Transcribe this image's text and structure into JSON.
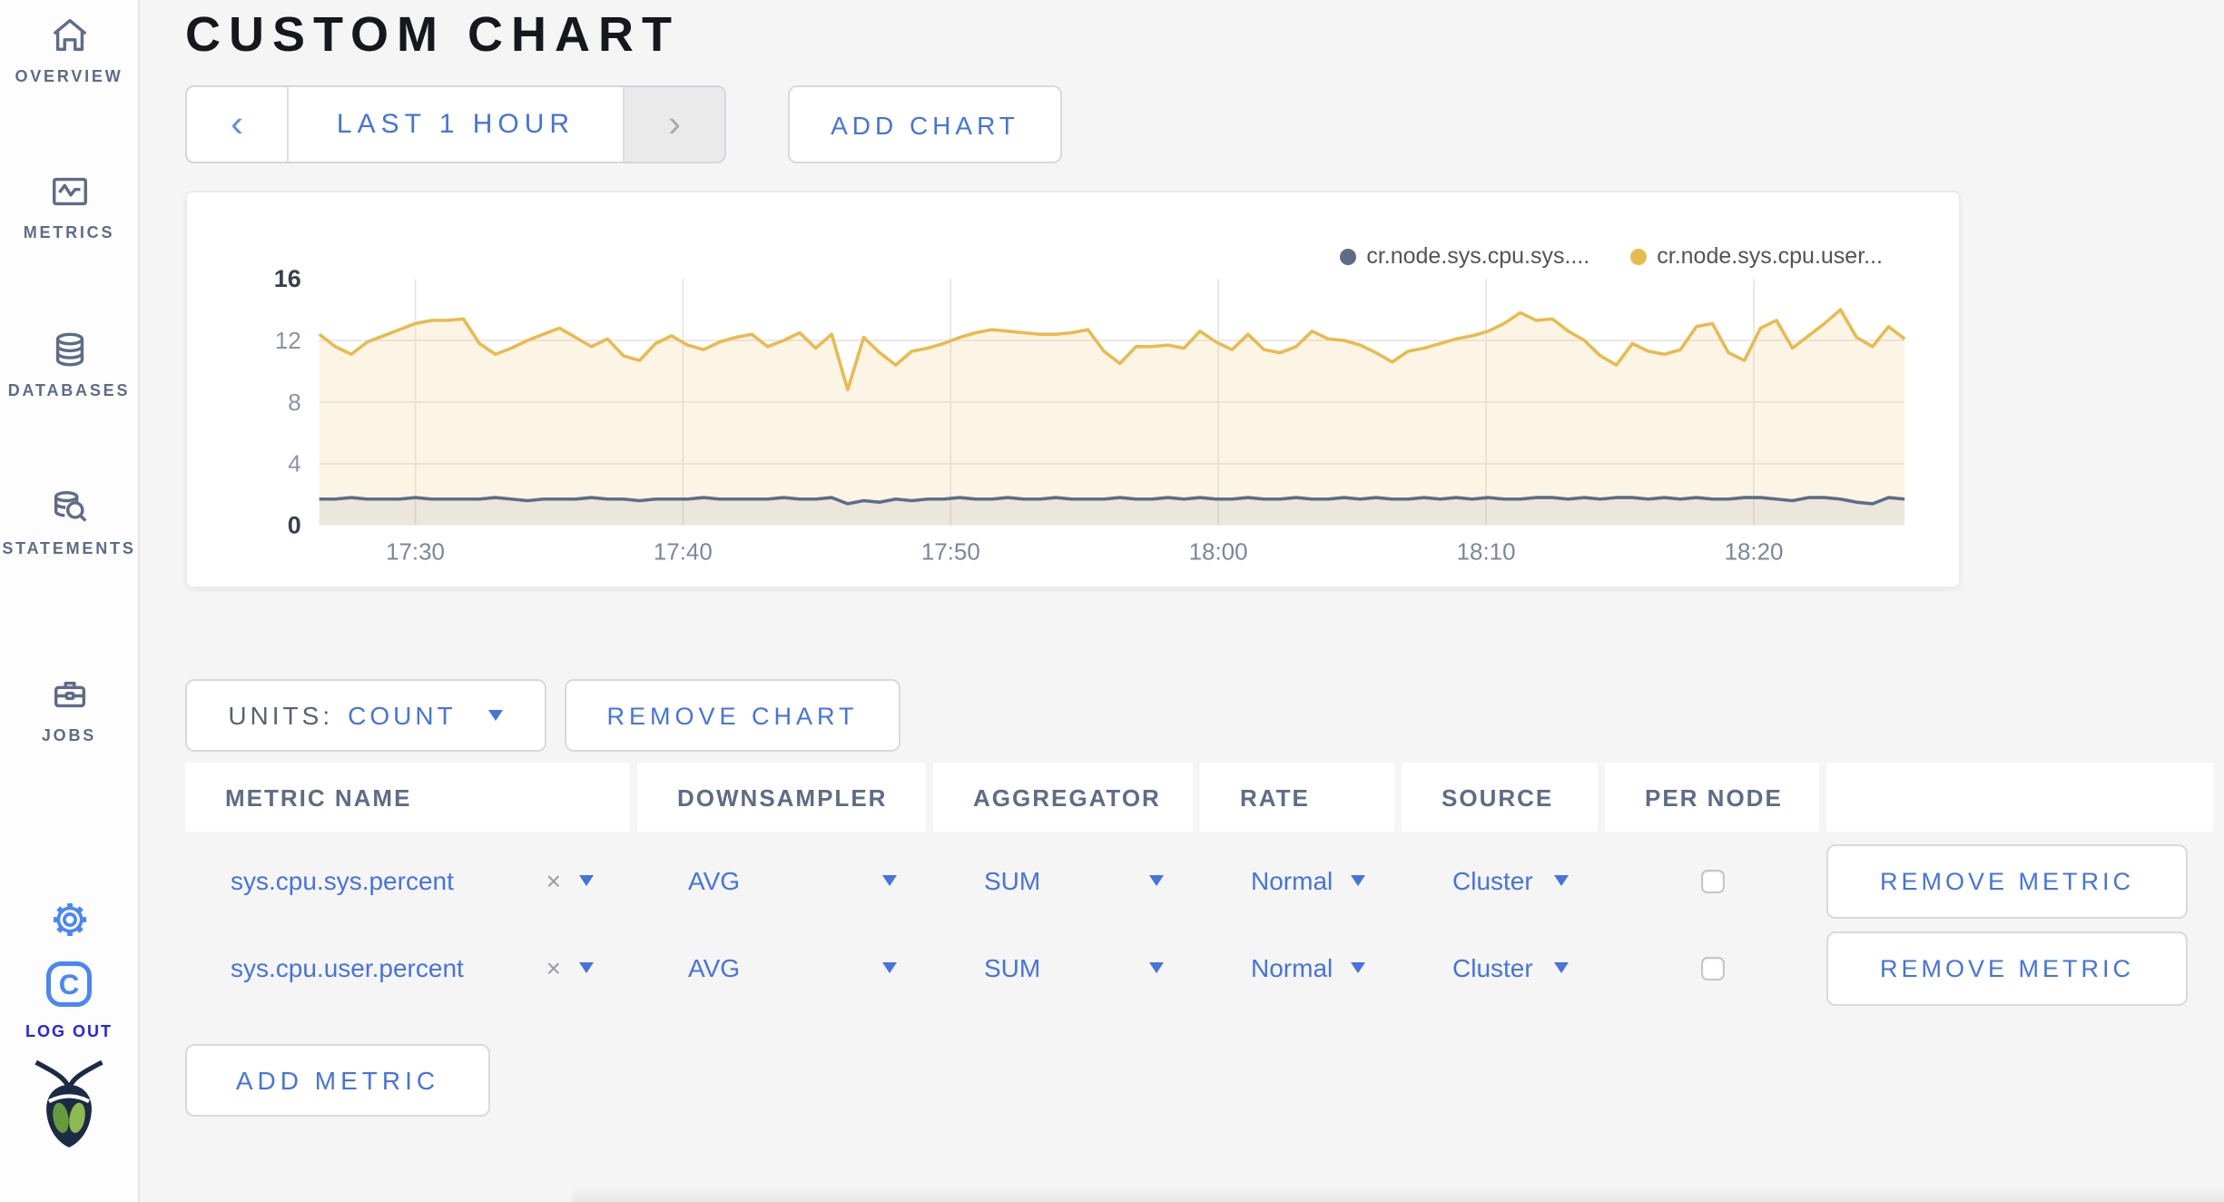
{
  "header": {
    "title": "CUSTOM CHART"
  },
  "sidebar": {
    "items": [
      {
        "label": "OVERVIEW"
      },
      {
        "label": "METRICS"
      },
      {
        "label": "DATABASES"
      },
      {
        "label": "STATEMENTS"
      },
      {
        "label": "JOBS"
      }
    ],
    "logout_label": "LOG OUT"
  },
  "toolbar": {
    "prev_arrow": "‹",
    "time_range_label": "LAST 1 HOUR",
    "next_arrow": "›",
    "add_chart_label": "ADD CHART"
  },
  "chart_controls": {
    "units_label": "UNITS:",
    "units_value": "COUNT",
    "remove_chart_label": "REMOVE CHART",
    "remove_metric_label": "REMOVE METRIC",
    "add_metric_label": "ADD METRIC"
  },
  "chart_data": {
    "type": "line",
    "title": "",
    "xlabel": "",
    "ylabel": "",
    "ylim": [
      0,
      16
    ],
    "yticks": [
      0,
      4,
      8,
      12,
      16
    ],
    "grid": true,
    "legend_position": "top-right",
    "xticks": [
      {
        "label": "17:30",
        "pos": 0.0606
      },
      {
        "label": "17:40",
        "pos": 0.2294
      },
      {
        "label": "17:50",
        "pos": 0.3983
      },
      {
        "label": "18:00",
        "pos": 0.5671
      },
      {
        "label": "18:10",
        "pos": 0.736
      },
      {
        "label": "18:20",
        "pos": 0.9049
      }
    ],
    "legend": [
      {
        "name": "cr.node.sys.cpu.sys....",
        "color": "#5f6c87"
      },
      {
        "name": "cr.node.sys.cpu.user...",
        "color": "#e8bb4f"
      }
    ],
    "series": [
      {
        "name": "cr.node.sys.cpu.sys....",
        "color": "#5f6c87",
        "fill": "rgba(95,108,135,0.10)",
        "values": [
          1.7,
          1.7,
          1.8,
          1.7,
          1.7,
          1.7,
          1.8,
          1.7,
          1.7,
          1.7,
          1.7,
          1.8,
          1.7,
          1.6,
          1.7,
          1.7,
          1.7,
          1.8,
          1.7,
          1.7,
          1.6,
          1.7,
          1.7,
          1.7,
          1.8,
          1.7,
          1.7,
          1.7,
          1.7,
          1.8,
          1.7,
          1.7,
          1.8,
          1.4,
          1.6,
          1.5,
          1.7,
          1.6,
          1.7,
          1.7,
          1.8,
          1.7,
          1.7,
          1.8,
          1.7,
          1.7,
          1.8,
          1.7,
          1.7,
          1.7,
          1.8,
          1.7,
          1.7,
          1.8,
          1.7,
          1.8,
          1.7,
          1.7,
          1.8,
          1.7,
          1.7,
          1.8,
          1.7,
          1.7,
          1.8,
          1.7,
          1.8,
          1.7,
          1.7,
          1.8,
          1.7,
          1.8,
          1.7,
          1.8,
          1.7,
          1.7,
          1.8,
          1.8,
          1.7,
          1.8,
          1.7,
          1.8,
          1.8,
          1.7,
          1.8,
          1.7,
          1.8,
          1.7,
          1.7,
          1.8,
          1.8,
          1.7,
          1.6,
          1.8,
          1.8,
          1.7,
          1.5,
          1.4,
          1.8,
          1.7
        ]
      },
      {
        "name": "cr.node.sys.cpu.user...",
        "color": "#e8bb4f",
        "fill": "rgba(232,187,79,0.14)",
        "values": [
          12.4,
          11.6,
          11.1,
          11.9,
          12.3,
          12.7,
          13.1,
          13.3,
          13.3,
          13.4,
          11.8,
          11.1,
          11.5,
          12.0,
          12.4,
          12.8,
          12.2,
          11.6,
          12.1,
          11.0,
          10.7,
          11.8,
          12.3,
          11.7,
          11.4,
          11.9,
          12.2,
          12.4,
          11.6,
          12.0,
          12.5,
          11.5,
          12.4,
          8.8,
          12.2,
          11.2,
          10.4,
          11.3,
          11.5,
          11.8,
          12.2,
          12.5,
          12.7,
          12.6,
          12.5,
          12.4,
          12.4,
          12.5,
          12.7,
          11.3,
          10.5,
          11.6,
          11.6,
          11.7,
          11.5,
          12.6,
          11.9,
          11.4,
          12.4,
          11.4,
          11.2,
          11.6,
          12.6,
          12.1,
          12.0,
          11.7,
          11.2,
          10.6,
          11.3,
          11.5,
          11.8,
          12.1,
          12.3,
          12.6,
          13.1,
          13.8,
          13.3,
          13.4,
          12.6,
          12.0,
          11.0,
          10.4,
          11.8,
          11.3,
          11.1,
          11.4,
          12.9,
          13.1,
          11.2,
          10.7,
          12.8,
          13.3,
          11.5,
          12.3,
          13.1,
          14.0,
          12.2,
          11.6,
          12.9,
          12.1
        ]
      }
    ]
  },
  "table": {
    "headers": [
      "METRIC NAME",
      "DOWNSAMPLER",
      "AGGREGATOR",
      "RATE",
      "SOURCE",
      "PER NODE",
      ""
    ],
    "clear_glyph": "×",
    "rows": [
      {
        "metric": "sys.cpu.sys.percent",
        "downsampler": "AVG",
        "aggregator": "SUM",
        "rate": "Normal",
        "source": "Cluster",
        "per_node": false
      },
      {
        "metric": "sys.cpu.user.percent",
        "downsampler": "AVG",
        "aggregator": "SUM",
        "rate": "Normal",
        "source": "Cluster",
        "per_node": false
      }
    ]
  }
}
